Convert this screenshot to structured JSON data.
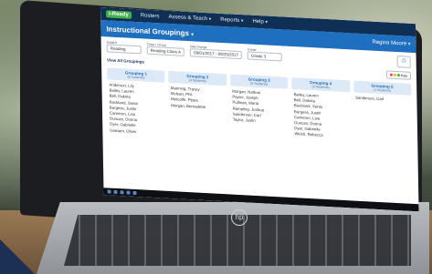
{
  "app": {
    "logo": "i-Ready",
    "nav": [
      "Rosters",
      "Assess & Teach",
      "Reports",
      "Help"
    ]
  },
  "page": {
    "title": "Instructional Groupings",
    "user": "Regina Moore"
  },
  "filters": [
    {
      "label": "Subject",
      "value": "Reading"
    },
    {
      "label": "Class / Group",
      "value": "Reading Class A"
    },
    {
      "label": "Date Range",
      "value": "09/01/2017 - 09/25/2017"
    },
    {
      "label": "Grade",
      "value": "Grade 3"
    }
  ],
  "toolbar": {
    "view_all": "View All Groupings",
    "key_label": "Key"
  },
  "groups": [
    {
      "name": "Grouping 1",
      "count": "(8 Students)",
      "students": [
        "Anderson, Lily",
        "Bailey, Lauren",
        "Bell, Dakota",
        "Buckland, Sonia",
        "Burgess, Justin",
        "Cameron, Lisa",
        "Duncan, Donna",
        "Dyer, Gabrielle",
        "Graham, Oliver"
      ]
    },
    {
      "name": "Grouping 2",
      "count": "(4 Students)",
      "students": [
        "Manning, Tracey",
        "Mclean, Phil",
        "Metcalfe, Pippa",
        "Morgan, Bernadette"
      ]
    },
    {
      "name": "Grouping 3",
      "count": "(6 Students)",
      "students": [
        "Morgan, Nathan",
        "Payne, Joseph",
        "Pullman, Maria",
        "Rampling, Joshua",
        "Sanderson, Carl",
        "Taylor, Justin"
      ]
    },
    {
      "name": "Grouping 4",
      "count": "(8 Students)",
      "students": [
        "Bailey, Lauren",
        "Bell, Dakota",
        "Buckland, Sonia",
        "Burgess, Justin",
        "Cameron, Lisa",
        "Duncan, Donna",
        "Dyer, Gabrielle",
        "Welch, Rebecca"
      ]
    },
    {
      "name": "Grouping 5",
      "count": "(1 Students)",
      "students": [
        "Sanderson, Carl"
      ]
    }
  ],
  "colors": {
    "topbar": "#0f2f55",
    "subbar": "#1f6fc0",
    "logo_green": "#43b14b",
    "key_dots": [
      "#e94b3c",
      "#f3b92b",
      "#43b14b"
    ]
  },
  "hp_logo": "hp"
}
